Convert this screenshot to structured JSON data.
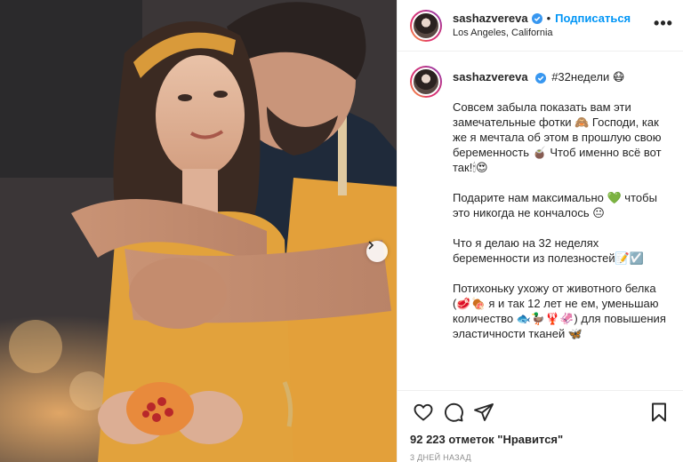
{
  "post": {
    "username": "sashazvereva",
    "follow_label": "Подписаться",
    "location": "Los Angeles, California",
    "more_label": "•••",
    "caption": {
      "first_line": "#32недели 😷",
      "paragraphs": [
        "Совсем забыла показать вам эти замечательные фотки 🙈 Господи, как же я мечтала об этом в прошлую свою беременность 🧉 Чтоб именно всё вот так!🕯😍",
        "Подарите нам максимально 💚 чтобы это никогда не кончалось 😐",
        "Что я делаю на 32 неделях беременности из полезностей📝☑️",
        "Потихоньку ухожу от животного белка (🥩🍖 я и так 12 лет не ем, уменьшаю количество 🐟🦆🦞🦑) для повышения эластичности тканей 🦋"
      ]
    },
    "likes_text": "92 223 отметок \"Нравится\"",
    "age_text": "3 дней назад"
  },
  "icons": {
    "verified": "verified-badge-icon",
    "like": "heart-icon",
    "comment": "comment-icon",
    "share": "paper-plane-icon",
    "save": "bookmark-icon",
    "next": "chevron-right-icon"
  },
  "colors": {
    "accent": "#0095f6",
    "text": "#262626",
    "muted": "#8e8e8e",
    "border": "#efefef",
    "apron": "#e8a23a"
  }
}
